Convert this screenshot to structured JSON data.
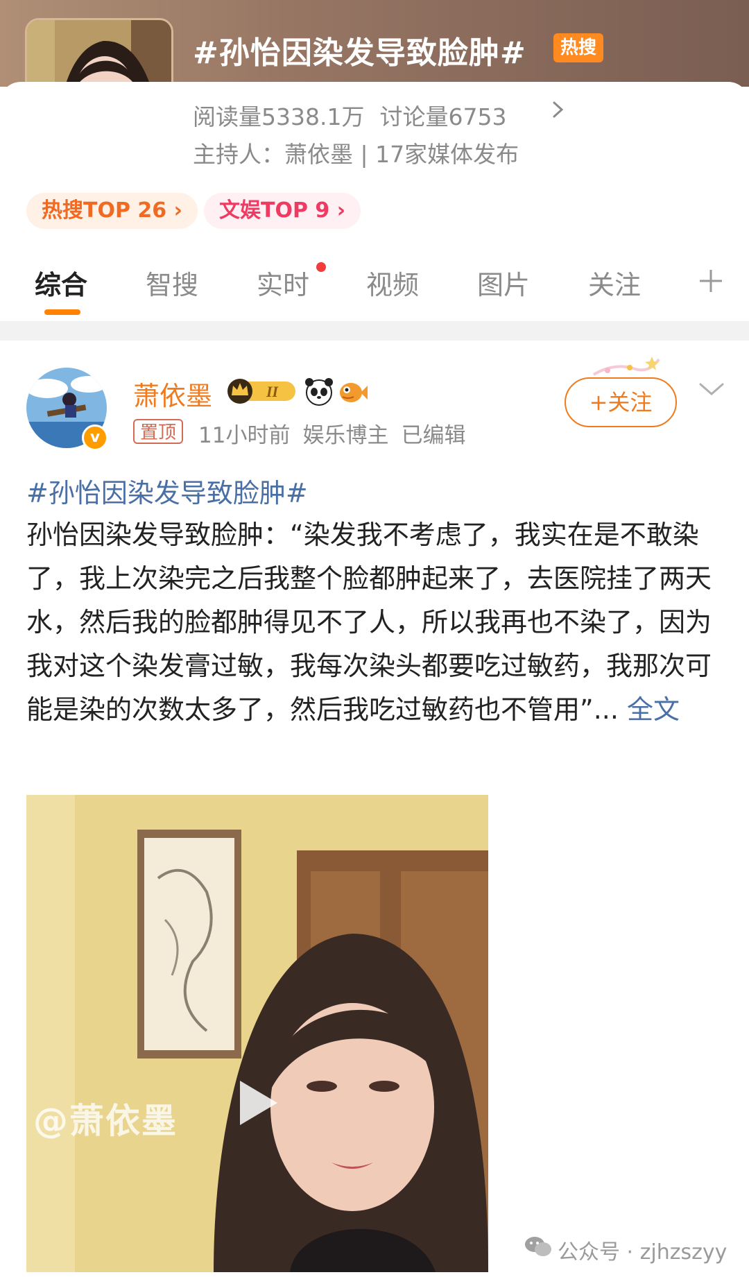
{
  "topic": {
    "title": "#孙怡因染发导致脸肿#",
    "hot_badge": "热搜",
    "reads": "阅读量5338.1万",
    "discussions": "讨论量6753",
    "host": "主持人：萧依墨 | 17家媒体发布",
    "rank_hot": "热搜TOP 26 ›",
    "rank_ent": "文娱TOP 9 ›"
  },
  "tabs": [
    "综合",
    "智搜",
    "实时",
    "视频",
    "图片",
    "关注"
  ],
  "post": {
    "author": "萧依墨",
    "pinned_label": "置顶",
    "time": "11小时前",
    "role": "娱乐博主",
    "edited": "已编辑",
    "follow_label": "+关注",
    "hashtag": "#孙怡因染发导致脸肿#",
    "body": "孙怡因染发导致脸肿：“染发我不考虑了，我实在是不敢染了，我上次染完之后我整个脸都肿起来了，去医院挂了两天水，然后我的脸都肿得见不了人，所以我再也不染了，因为我对这个染发膏过敏，我每次染头都要吃过敏药，我那次可能是染的次数太多了，然后我吃过敏药也不管用”... ",
    "full_text_link": "全文",
    "video_watermark": "@萧依墨"
  },
  "footer_watermark": "公众号 · zjhzszyy",
  "colors": {
    "accent": "#ff8200",
    "link": "#4a6fa5",
    "author": "#f07b1e",
    "hot_badge": "#ff8a1f"
  }
}
